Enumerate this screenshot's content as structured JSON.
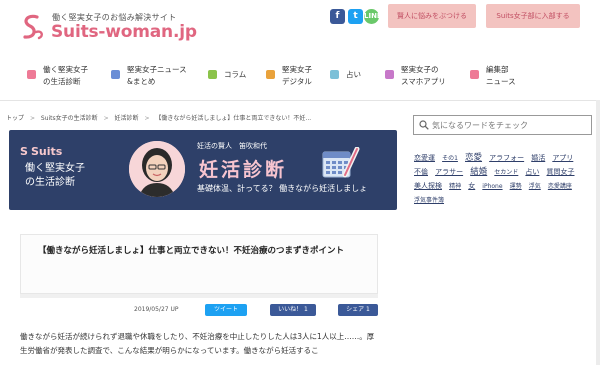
{
  "header": {
    "tagline": "働く堅実女子のお悩み解決サイト",
    "logo_text": "Suits-woman.jp",
    "social": {
      "facebook": "f",
      "twitter": "t",
      "line": "LINE"
    },
    "consult_button": "賢人に悩みをぶつける",
    "join_button": "Suits女子部に入部する",
    "colors": {
      "brand_pink": "#e06680",
      "button_pink": "#f3c3c0",
      "navy": "#2e4069"
    }
  },
  "nav": {
    "items": [
      {
        "label": "働く堅実女子\nの生活診断",
        "icon": "heart-icon",
        "color": "#ee7a96"
      },
      {
        "label": "堅実女子ニュース\n&まとめ",
        "icon": "news-icon",
        "color": "#6a8ed6"
      },
      {
        "label": "コラム",
        "icon": "book-icon",
        "color": "#8bc34a"
      },
      {
        "label": "堅実女子\nデジタル",
        "icon": "pen-icon",
        "color": "#e9a23b"
      },
      {
        "label": "占い",
        "icon": "star-icon",
        "color": "#7cc0d8"
      },
      {
        "label": "堅実女子の\nスマホアプリ",
        "icon": "phone-icon",
        "color": "#c778c9"
      },
      {
        "label": "編集部\nニュース",
        "icon": "bubble-icon",
        "color": "#ee7a96"
      }
    ]
  },
  "breadcrumb": {
    "items": [
      "トップ",
      "Suits女子の生活診断",
      "妊活診断",
      "【働きながら妊活しましょ】仕事と両立できない！不妊..."
    ],
    "separator": ">"
  },
  "banner": {
    "suits": "Suits",
    "title": "働く堅実女子\nの生活診断",
    "name": "妊活の賢人　笛吹和代",
    "big_title": "妊活診断",
    "subtitle": "基礎体温、計ってる？ 働きながら妊活しましょ"
  },
  "article": {
    "title": "【働きながら妊活しましょ】仕事と両立できない！不妊治療のつまずきポイント",
    "date": "2019/05/27 UP",
    "tweet": "ツイート",
    "like": "いいね！ 1",
    "share": "シェア 1",
    "body": "働きながら妊活が続けられず退職や休職をしたり、不妊治療を中止したりした人は3人に1人以上……。厚生労働省が発表した調査で、こんな結果が明らかになっています。働きながら妊活するこ"
  },
  "sidebar": {
    "search_placeholder": "気になるワードをチェック",
    "tags": [
      {
        "text": "恋愛運",
        "size": "m"
      },
      {
        "text": "その1",
        "size": "s"
      },
      {
        "text": "恋愛",
        "size": "l"
      },
      {
        "text": "アラフォー",
        "size": "m"
      },
      {
        "text": "婚活",
        "size": "m"
      },
      {
        "text": "アプリ",
        "size": "m"
      },
      {
        "text": "不倫",
        "size": "m"
      },
      {
        "text": "アラサー",
        "size": "m"
      },
      {
        "text": "結婚",
        "size": "l"
      },
      {
        "text": "セカンド",
        "size": "s"
      },
      {
        "text": "占い",
        "size": "m"
      },
      {
        "text": "質問女子",
        "size": "m"
      },
      {
        "text": "美人探検",
        "size": "m"
      },
      {
        "text": "精神",
        "size": "s"
      },
      {
        "text": "女",
        "size": "m"
      },
      {
        "text": "iPhone",
        "size": "s"
      },
      {
        "text": "運勢",
        "size": "s"
      },
      {
        "text": "浮気",
        "size": "s"
      },
      {
        "text": "恋愛講座",
        "size": "s"
      },
      {
        "text": "浮気事件簿",
        "size": "s"
      }
    ]
  }
}
